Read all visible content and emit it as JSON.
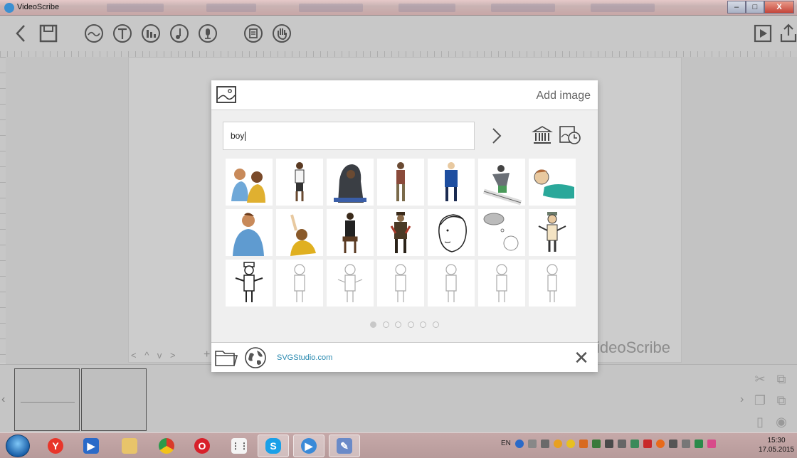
{
  "window": {
    "title": "VideoScribe",
    "buttons": {
      "minimize": "–",
      "maximize": "□",
      "close": "X"
    }
  },
  "toolbar": {
    "left": [
      "back-icon",
      "save-icon",
      "add-image-icon",
      "add-text-icon",
      "add-chart-icon",
      "music-icon",
      "voiceover-icon",
      "properties-icon",
      "hand-icon"
    ],
    "right": [
      "play-icon",
      "share-icon"
    ]
  },
  "canvas": {
    "brand": "ideoScribe",
    "nav": "< ^ v >",
    "plus": "+"
  },
  "modal": {
    "title": "Add image",
    "search": {
      "value": "boy"
    },
    "pager": {
      "pages": 6,
      "active": 1
    },
    "footer": {
      "link": "SVGStudio.com",
      "close": "✕"
    },
    "thumbnails": [
      "two-kids-sitting",
      "boy-white-shirt",
      "hooded-boy-crouching",
      "boy-walking",
      "boy-blue-jacket",
      "snowboarder",
      "boy-lying-down",
      "boy-blue-shirt",
      "girl-raising-hand",
      "boy-on-stool",
      "boy-standing-brown",
      "boy-face-sketch",
      "boy-thinking-cloud",
      "boy-shrugging",
      "boy-shrugging-bw",
      "boy-outline-1",
      "boy-outline-2",
      "boy-outline-3",
      "boy-outline-4",
      "boy-outline-5",
      "boy-outline-6"
    ]
  },
  "timeline": {
    "tools": [
      "scissors-icon",
      "copy-icon",
      "paste-icon",
      "eye-icon",
      "group-icon",
      "ungroup-icon"
    ]
  },
  "taskbar": {
    "apps": [
      "yandex-browser",
      "media-player",
      "file-explorer",
      "chrome",
      "opera",
      "app-grid",
      "skype",
      "videoscribe",
      "paint"
    ],
    "language": "EN",
    "time": "15:30",
    "date": "17.05.2015"
  },
  "colors": {
    "accent_link": "#2a8ab0",
    "modal_bg": "#efefef",
    "taskbar": "#b79a9a"
  }
}
